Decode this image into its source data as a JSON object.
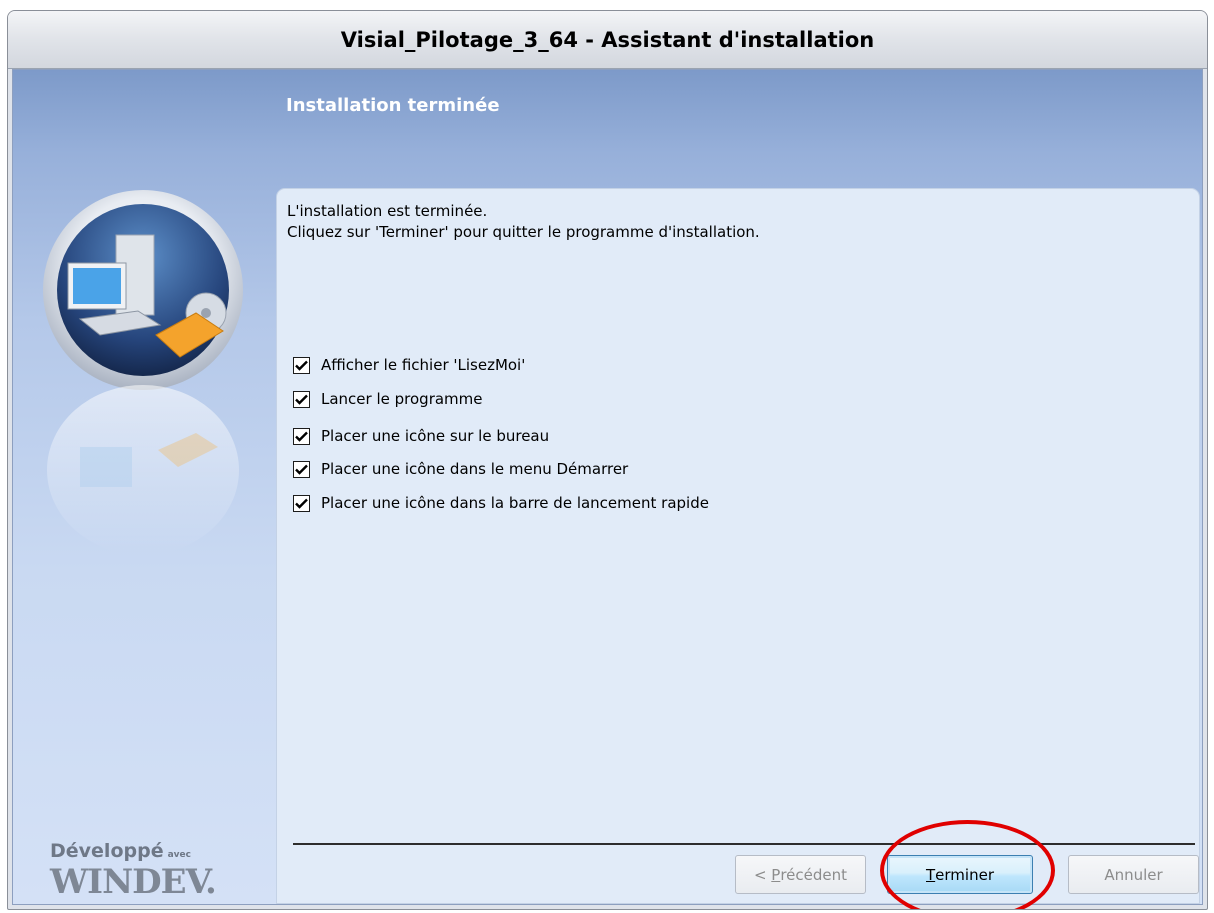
{
  "window": {
    "title": "Visial_Pilotage_3_64 - Assistant d'installation"
  },
  "header": {
    "title": "Installation terminée"
  },
  "brand": {
    "line1": "Développé",
    "line1_small": "avec",
    "line2": "WINDEV."
  },
  "panel": {
    "intro": "L'installation est terminée.\nCliquez sur 'Terminer' pour quitter le programme d'installation."
  },
  "options": [
    {
      "label": "Afficher le fichier 'LisezMoi'",
      "checked": true
    },
    {
      "label": "Lancer le programme",
      "checked": true
    },
    {
      "label": "Placer une icône sur le bureau",
      "checked": true
    },
    {
      "label": "Placer une icône dans le menu Démarrer",
      "checked": true
    },
    {
      "label": "Placer une icône dans la barre de lancement rapide",
      "checked": true
    }
  ],
  "buttons": {
    "previous": {
      "prefix": "< ",
      "mnemonic": "P",
      "rest": "récédent",
      "enabled": false
    },
    "finish": {
      "mnemonic": "T",
      "rest": "erminer",
      "enabled": true
    },
    "cancel": {
      "label": "Annuler",
      "enabled": false
    }
  },
  "annotation": {
    "color": "#e00000",
    "target": "finish"
  }
}
